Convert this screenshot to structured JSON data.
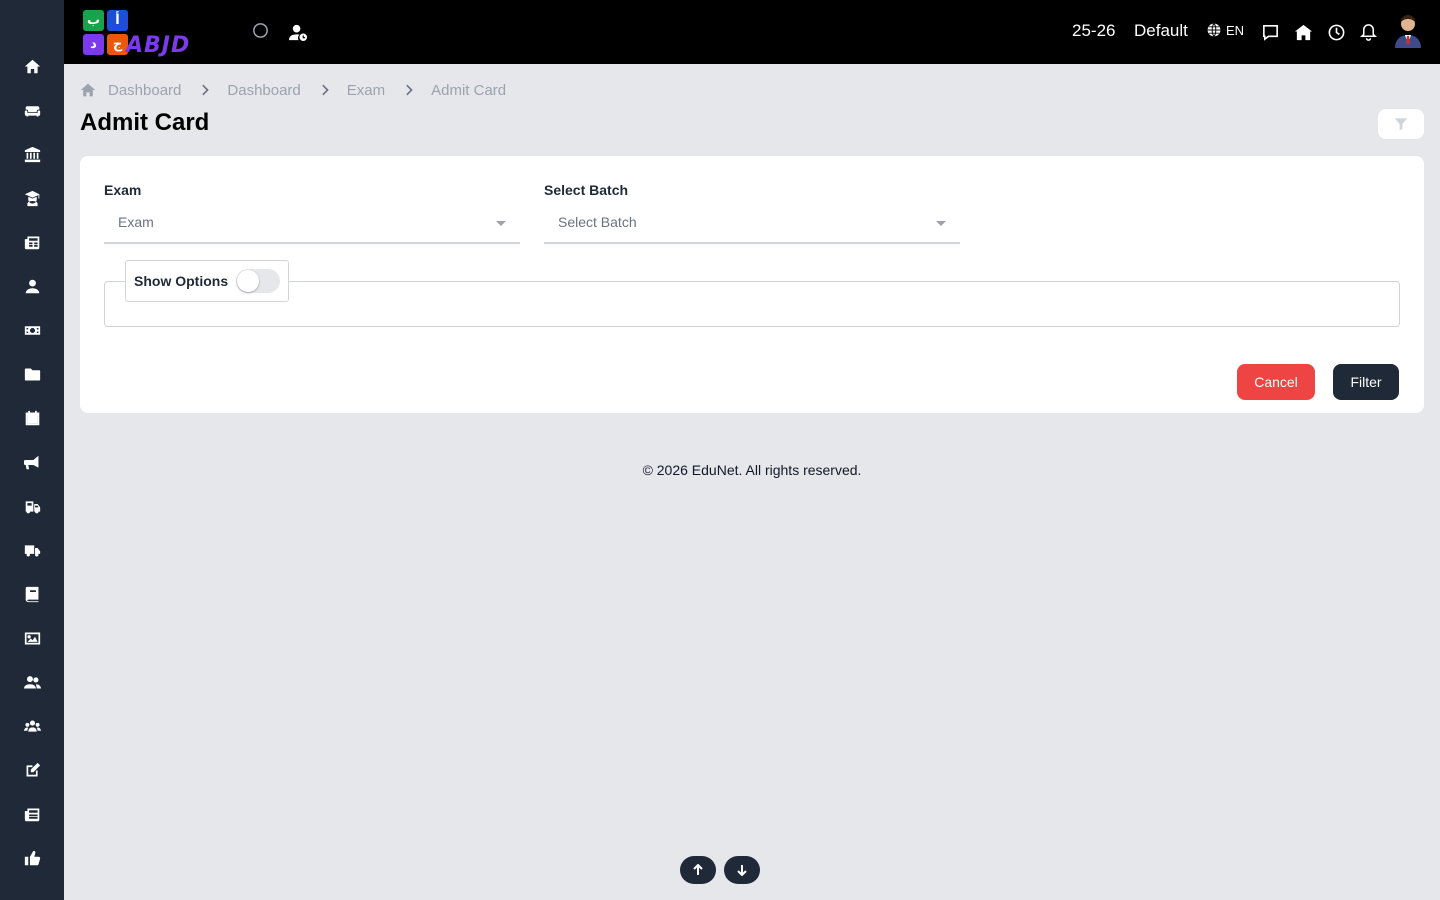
{
  "sidebar": {
    "items": [
      {
        "icon": "home-icon"
      },
      {
        "icon": "sofa-icon"
      },
      {
        "icon": "institution-icon"
      },
      {
        "icon": "graduate-icon"
      },
      {
        "icon": "newspaper-icon"
      },
      {
        "icon": "teacher-icon"
      },
      {
        "icon": "money-icon"
      },
      {
        "icon": "folder-icon"
      },
      {
        "icon": "calendar-icon"
      },
      {
        "icon": "megaphone-icon"
      },
      {
        "icon": "school-bus-icon"
      },
      {
        "icon": "truck-icon"
      },
      {
        "icon": "book-icon"
      },
      {
        "icon": "image-icon"
      },
      {
        "icon": "users-icon"
      },
      {
        "icon": "group-icon"
      },
      {
        "icon": "edit-icon"
      },
      {
        "icon": "news-icon"
      },
      {
        "icon": "thumbs-up-icon"
      }
    ]
  },
  "header": {
    "logo_text": "ABJD",
    "logo_tiles": [
      "ب",
      "أ",
      "د",
      "ج"
    ],
    "session": "25-26",
    "profile": "Default",
    "language": "EN",
    "accent_color": "#7c3aed"
  },
  "breadcrumb": {
    "items": [
      "Dashboard",
      "Dashboard",
      "Exam",
      "Admit Card"
    ]
  },
  "page": {
    "title": "Admit Card"
  },
  "form": {
    "exam": {
      "label": "Exam",
      "placeholder": "Exam"
    },
    "batch": {
      "label": "Select Batch",
      "placeholder": "Select Batch"
    },
    "show_options_label": "Show Options",
    "show_options_enabled": false,
    "cancel_label": "Cancel",
    "filter_label": "Filter"
  },
  "footer": {
    "text": "© 2026 EduNet. All rights reserved."
  },
  "colors": {
    "sidebar_bg": "#1f2937",
    "topbar_bg": "#000000",
    "page_bg": "#e5e7eb",
    "cancel": "#ef4444",
    "primary": "#1f2937"
  }
}
